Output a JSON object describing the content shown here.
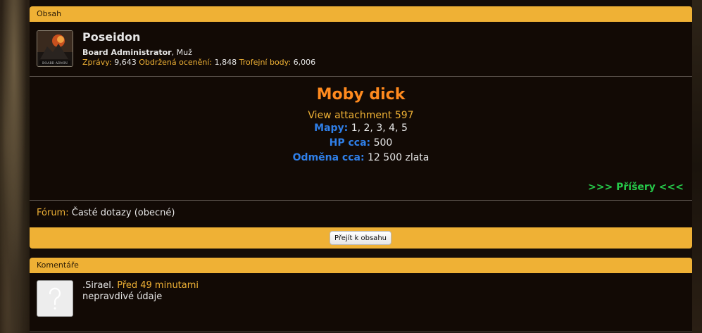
{
  "content_panel": {
    "header": "Obsah",
    "author": {
      "username": "Poseidon",
      "role": "Board Administrator",
      "gender": ", Muž",
      "messages_label": "Zprávy:",
      "messages_value": "9,643",
      "likes_label": "Obdržená ocenění:",
      "likes_value": "1,848",
      "trophy_label": "Trofejní body:",
      "trophy_value": "6,006",
      "avatar_caption": "BOARD ADMIN"
    },
    "entry": {
      "title": "Moby dick",
      "attachment": "View attachment 597",
      "maps_label": "Mapy:",
      "maps_value": " 1, 2, 3, 4, 5",
      "hp_label": "HP cca:",
      "hp_value": " 500",
      "reward_label": "Odměna cca:",
      "reward_value": " 12 500 zlata",
      "monsters_link": ">>> Příšery <<<"
    },
    "forum_label": "Fórum:",
    "forum_value": " Časté dotazy (obecné)",
    "goto_button": "Přejít k obsahu"
  },
  "comments_panel": {
    "header": "Komentáře",
    "comments": [
      {
        "author": ".Sirael.",
        "time": "Před 49 minutami",
        "text": "nepravdivé údaje"
      }
    ]
  },
  "colors": {
    "accent": "#efb135",
    "title_orange": "#ff8a1e",
    "label_blue": "#2f7fe8",
    "link_green": "#26c94a"
  }
}
